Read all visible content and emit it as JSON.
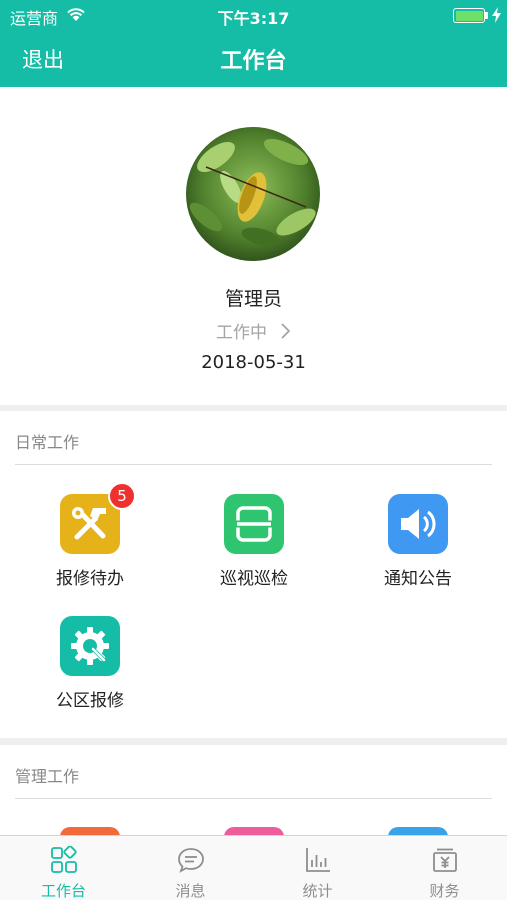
{
  "status_bar": {
    "carrier": "运营商",
    "time": "下午3:17",
    "battery_level": 1.0
  },
  "nav": {
    "logout": "退出",
    "title": "工作台"
  },
  "profile": {
    "name": "管理员",
    "status": "工作中",
    "date": "2018-05-31"
  },
  "daily": {
    "title": "日常工作",
    "items": [
      {
        "label": "报修待办",
        "icon": "tools-icon",
        "color": "#e6b219",
        "badge": "5"
      },
      {
        "label": "巡视巡检",
        "icon": "scan-icon",
        "color": "#2fc46f"
      },
      {
        "label": "通知公告",
        "icon": "speaker-icon",
        "color": "#3f98f2"
      },
      {
        "label": "公区报修",
        "icon": "gear-wrench-icon",
        "color": "#16bda6"
      }
    ]
  },
  "manage": {
    "title": "管理工作",
    "peek_colors": [
      "#f06a3a",
      "#ef5c9b",
      "#3aa3e8"
    ]
  },
  "tabbar": {
    "items": [
      {
        "label": "工作台",
        "icon": "grid-icon",
        "active": true
      },
      {
        "label": "消息",
        "icon": "message-icon",
        "active": false
      },
      {
        "label": "统计",
        "icon": "chart-icon",
        "active": false
      },
      {
        "label": "财务",
        "icon": "finance-icon",
        "active": false
      }
    ]
  },
  "colors": {
    "primary": "#16bda6",
    "background": "#efefef",
    "badge": "#f02f2f"
  }
}
